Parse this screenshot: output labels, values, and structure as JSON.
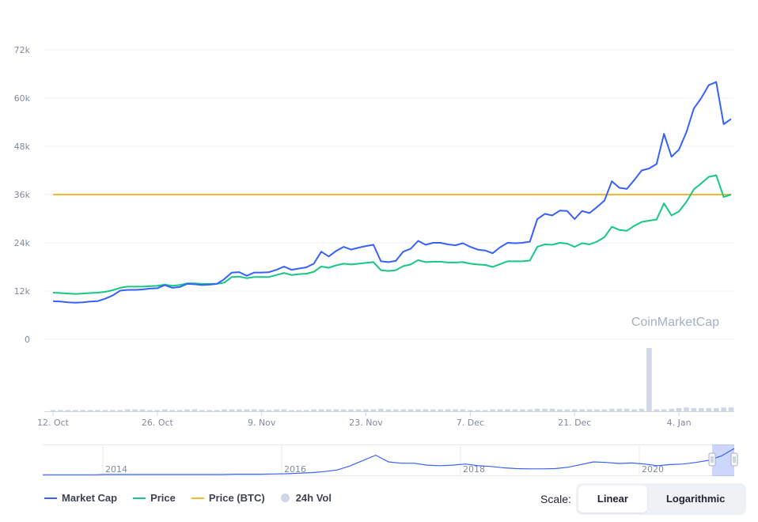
{
  "chart_data": {
    "type": "line",
    "x": [
      "2020-10-12",
      "2020-10-13",
      "2020-10-14",
      "2020-10-15",
      "2020-10-16",
      "2020-10-17",
      "2020-10-18",
      "2020-10-19",
      "2020-10-20",
      "2020-10-21",
      "2020-10-22",
      "2020-10-23",
      "2020-10-24",
      "2020-10-25",
      "2020-10-26",
      "2020-10-27",
      "2020-10-28",
      "2020-10-29",
      "2020-10-30",
      "2020-10-31",
      "2020-11-01",
      "2020-11-02",
      "2020-11-03",
      "2020-11-04",
      "2020-11-05",
      "2020-11-06",
      "2020-11-07",
      "2020-11-08",
      "2020-11-09",
      "2020-11-10",
      "2020-11-11",
      "2020-11-12",
      "2020-11-13",
      "2020-11-14",
      "2020-11-15",
      "2020-11-16",
      "2020-11-17",
      "2020-11-18",
      "2020-11-19",
      "2020-11-20",
      "2020-11-21",
      "2020-11-22",
      "2020-11-23",
      "2020-11-24",
      "2020-11-25",
      "2020-11-26",
      "2020-11-27",
      "2020-11-28",
      "2020-11-29",
      "2020-11-30",
      "2020-12-01",
      "2020-12-02",
      "2020-12-03",
      "2020-12-04",
      "2020-12-05",
      "2020-12-06",
      "2020-12-07",
      "2020-12-08",
      "2020-12-09",
      "2020-12-10",
      "2020-12-11",
      "2020-12-12",
      "2020-12-13",
      "2020-12-14",
      "2020-12-15",
      "2020-12-16",
      "2020-12-17",
      "2020-12-18",
      "2020-12-19",
      "2020-12-20",
      "2020-12-21",
      "2020-12-22",
      "2020-12-23",
      "2020-12-24",
      "2020-12-25",
      "2020-12-26",
      "2020-12-27",
      "2020-12-28",
      "2020-12-29",
      "2020-12-30",
      "2020-12-31",
      "2021-01-01",
      "2021-01-02",
      "2021-01-03",
      "2021-01-04",
      "2021-01-05",
      "2021-01-06",
      "2021-01-07",
      "2021-01-08",
      "2021-01-09",
      "2021-01-10",
      "2021-01-11"
    ],
    "series": [
      {
        "name": "Market Cap",
        "color": "#3861fb",
        "values": [
          9500,
          9400,
          9200,
          9100,
          9200,
          9400,
          9500,
          10100,
          10900,
          12100,
          12300,
          12300,
          12400,
          12600,
          12700,
          13500,
          12800,
          13000,
          13800,
          13700,
          13500,
          13600,
          13800,
          15000,
          16600,
          16700,
          15800,
          16600,
          16600,
          16700,
          17300,
          18100,
          17300,
          17600,
          17900,
          18800,
          21800,
          20600,
          22000,
          23000,
          22300,
          22800,
          23200,
          23500,
          19400,
          19200,
          19500,
          21800,
          22500,
          24500,
          23500,
          24000,
          24000,
          23600,
          23400,
          23900,
          23000,
          22300,
          22100,
          21400,
          22900,
          24000,
          23900,
          24000,
          24300,
          29900,
          31200,
          30800,
          32000,
          31900,
          29900,
          31900,
          31400,
          32900,
          34500,
          39300,
          37700,
          37400,
          39600,
          42000,
          42500,
          43600,
          51100,
          45400,
          47200,
          51500,
          57400,
          60000,
          63200,
          64000,
          53500,
          54800
        ]
      },
      {
        "name": "Price",
        "color": "#16c784",
        "values": [
          11600,
          11500,
          11400,
          11300,
          11400,
          11500,
          11600,
          11800,
          12200,
          12800,
          13100,
          13100,
          13100,
          13200,
          13300,
          13600,
          13300,
          13500,
          13900,
          13900,
          13800,
          13800,
          13800,
          14100,
          15500,
          15600,
          15200,
          15500,
          15500,
          15500,
          16000,
          16500,
          16000,
          16200,
          16300,
          16800,
          18100,
          17800,
          18400,
          18800,
          18600,
          18800,
          19000,
          19200,
          17200,
          17000,
          17200,
          18200,
          18600,
          19700,
          19200,
          19300,
          19300,
          19100,
          19100,
          19200,
          18800,
          18600,
          18500,
          18000,
          18700,
          19400,
          19400,
          19400,
          19600,
          23000,
          23600,
          23500,
          24000,
          23800,
          23000,
          23900,
          23600,
          24300,
          25400,
          28000,
          27200,
          27000,
          28200,
          29200,
          29500,
          29800,
          33800,
          30800,
          31800,
          34200,
          37300,
          38800,
          40400,
          40800,
          35400,
          36000
        ]
      },
      {
        "name": "Price (BTC)",
        "color": "#f3ba2f",
        "values": [
          36000,
          36000,
          36000,
          36000,
          36000,
          36000,
          36000,
          36000,
          36000,
          36000,
          36000,
          36000,
          36000,
          36000,
          36000,
          36000,
          36000,
          36000,
          36000,
          36000,
          36000,
          36000,
          36000,
          36000,
          36000,
          36000,
          36000,
          36000,
          36000,
          36000,
          36000,
          36000,
          36000,
          36000,
          36000,
          36000,
          36000,
          36000,
          36000,
          36000,
          36000,
          36000,
          36000,
          36000,
          36000,
          36000,
          36000,
          36000,
          36000,
          36000,
          36000,
          36000,
          36000,
          36000,
          36000,
          36000,
          36000,
          36000,
          36000,
          36000,
          36000,
          36000,
          36000,
          36000,
          36000,
          36000,
          36000,
          36000,
          36000,
          36000,
          36000,
          36000,
          36000,
          36000,
          36000,
          36000,
          36000,
          36000,
          36000,
          36000,
          36000,
          36000,
          36000,
          36000,
          36000,
          36000,
          36000,
          36000,
          36000,
          36000,
          36000,
          36000
        ]
      },
      {
        "name": "24h Vol",
        "color": "#cfd6e4",
        "values": [
          2,
          2,
          2,
          2,
          2,
          2,
          2,
          2,
          2,
          2,
          3,
          3,
          3,
          2,
          2,
          3,
          2,
          2,
          3,
          3,
          2,
          2,
          2,
          3,
          3,
          3,
          3,
          3,
          3,
          2,
          3,
          3,
          2,
          2,
          2,
          3,
          3,
          3,
          3,
          3,
          3,
          3,
          3,
          3,
          4,
          3,
          3,
          3,
          3,
          3,
          3,
          3,
          3,
          3,
          3,
          3,
          2,
          2,
          2,
          3,
          3,
          3,
          3,
          3,
          3,
          4,
          4,
          4,
          3,
          3,
          3,
          3,
          3,
          3,
          3,
          4,
          4,
          4,
          3,
          4,
          100,
          3,
          3,
          4,
          5,
          6,
          5,
          5,
          5,
          5,
          6,
          6
        ]
      }
    ],
    "ylim": [
      0,
      72000
    ],
    "yticks": [
      "0",
      "12k",
      "24k",
      "36k",
      "48k",
      "60k",
      "72k"
    ],
    "xticks": [
      {
        "date": "2020-10-12",
        "label": "12. Oct"
      },
      {
        "date": "2020-10-26",
        "label": "26. Oct"
      },
      {
        "date": "2020-11-09",
        "label": "9. Nov"
      },
      {
        "date": "2020-11-23",
        "label": "23. Nov"
      },
      {
        "date": "2020-12-07",
        "label": "7. Dec"
      },
      {
        "date": "2020-12-21",
        "label": "21. Dec"
      },
      {
        "date": "2021-01-04",
        "label": "4. Jan"
      }
    ],
    "grid": true,
    "legend_position": "bottom-left",
    "watermark": "CoinMarketCap",
    "navigator": {
      "labels": [
        "2014",
        "2016",
        "2018",
        "2020"
      ],
      "values": [
        0.02,
        0.02,
        0.02,
        0.02,
        0.02,
        0.03,
        0.03,
        0.03,
        0.03,
        0.03,
        0.03,
        0.03,
        0.03,
        0.03,
        0.03,
        0.04,
        0.04,
        0.04,
        0.05,
        0.06,
        0.08,
        0.1,
        0.14,
        0.2,
        0.35,
        0.55,
        0.75,
        0.5,
        0.45,
        0.45,
        0.38,
        0.36,
        0.38,
        0.42,
        0.36,
        0.33,
        0.28,
        0.25,
        0.24,
        0.24,
        0.25,
        0.3,
        0.4,
        0.5,
        0.48,
        0.44,
        0.46,
        0.42,
        0.36,
        0.4,
        0.42,
        0.48,
        0.56,
        0.72,
        1.0
      ]
    }
  },
  "legend": {
    "items": [
      {
        "label": "Market Cap",
        "color": "#3861fb",
        "kind": "line"
      },
      {
        "label": "Price",
        "color": "#16c784",
        "kind": "line"
      },
      {
        "label": "Price (BTC)",
        "color": "#f3ba2f",
        "kind": "line"
      },
      {
        "label": "24h Vol",
        "color": "#cfd6e4",
        "kind": "dot"
      }
    ]
  },
  "scale": {
    "label": "Scale:",
    "options": [
      {
        "label": "Linear",
        "active": true
      },
      {
        "label": "Logarithmic",
        "active": false
      }
    ]
  }
}
